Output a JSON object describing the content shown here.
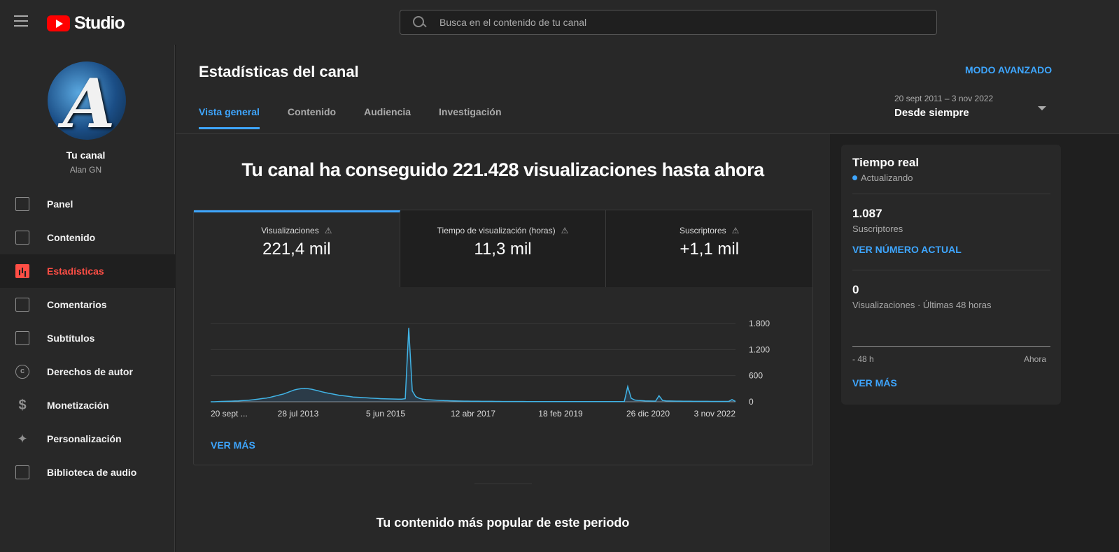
{
  "search": {
    "placeholder": "Busca en el contenido de tu canal"
  },
  "brand": {
    "studio_label": "Studio"
  },
  "channel": {
    "name": "Tu canal",
    "user": "Alan GN"
  },
  "sidebar": {
    "items": [
      {
        "label": "Panel",
        "icon": "dashboard-icon"
      },
      {
        "label": "Contenido",
        "icon": "content-icon"
      },
      {
        "label": "Estadísticas",
        "icon": "analytics-icon"
      },
      {
        "label": "Comentarios",
        "icon": "comments-icon"
      },
      {
        "label": "Subtítulos",
        "icon": "subtitles-icon"
      },
      {
        "label": "Derechos de autor",
        "icon": "copyright-icon"
      },
      {
        "label": "Monetización",
        "icon": "dollar-icon"
      },
      {
        "label": "Personalización",
        "icon": "magic-wand-icon"
      },
      {
        "label": "Biblioteca de audio",
        "icon": "audio-library-icon"
      }
    ]
  },
  "header": {
    "title": "Estadísticas del canal",
    "advanced_mode": "MODO AVANZADO",
    "date_range": "20 sept 2011 – 3 nov 2022",
    "date_preset": "Desde siempre",
    "tabs": [
      "Vista general",
      "Contenido",
      "Audiencia",
      "Investigación"
    ]
  },
  "overview": {
    "headline": "Tu canal ha conseguido 221.428 visualizaciones hasta ahora",
    "metrics": [
      {
        "label": "Visualizaciones",
        "value": "221,4 mil"
      },
      {
        "label": "Tiempo de visualización (horas)",
        "value": "11,3 mil"
      },
      {
        "label": "Suscriptores",
        "value": "+1,1 mil"
      }
    ],
    "see_more": "VER MÁS",
    "popular_title": "Tu contenido más popular de este periodo"
  },
  "realtime": {
    "title": "Tiempo real",
    "status": "Actualizando",
    "subscribers_value": "1.087",
    "subscribers_label": "Suscriptores",
    "see_current": "VER NÚMERO ACTUAL",
    "views_value": "0",
    "views_label": "Visualizaciones · Últimas 48 horas",
    "axis_start": "- 48 h",
    "axis_end": "Ahora",
    "see_more": "VER MÁS"
  },
  "colors": {
    "accent": "#3ea6ff",
    "active_nav": "#ff4e45",
    "brand_red": "#ff0000"
  },
  "chart_data": {
    "type": "line",
    "x_tick_labels": [
      "20 sept ...",
      "28 jul 2013",
      "5 jun 2015",
      "12 abr 2017",
      "18 feb 2019",
      "26 dic 2020",
      "3 nov 2022"
    ],
    "y_tick_labels": [
      "0",
      "600",
      "1.200",
      "1.800"
    ],
    "ylim": [
      0,
      1800
    ],
    "grid": true,
    "series": [
      {
        "values": [
          0,
          0,
          5,
          8,
          10,
          12,
          15,
          18,
          20,
          25,
          30,
          35,
          45,
          55,
          65,
          75,
          85,
          100,
          120,
          140,
          160,
          180,
          210,
          240,
          270,
          290,
          300,
          310,
          300,
          290,
          270,
          250,
          230,
          210,
          195,
          180,
          165,
          150,
          140,
          130,
          120,
          110,
          105,
          100,
          95,
          90,
          85,
          80,
          75,
          70,
          68,
          66,
          64,
          62,
          60,
          60,
          70,
          1700,
          250,
          120,
          80,
          60,
          50,
          45,
          40,
          35,
          30,
          28,
          25,
          22,
          20,
          18,
          16,
          15,
          14,
          13,
          12,
          11,
          10,
          10,
          9,
          9,
          8,
          8,
          7,
          7,
          7,
          6,
          6,
          6,
          6,
          5,
          5,
          5,
          5,
          5,
          5,
          5,
          5,
          5,
          5,
          5,
          5,
          5,
          5,
          5,
          5,
          5,
          5,
          5,
          5,
          5,
          5,
          5,
          5,
          5,
          5,
          5,
          5,
          5,
          350,
          80,
          40,
          30,
          25,
          20,
          18,
          16,
          15,
          140,
          30,
          20,
          18,
          16,
          15,
          14,
          13,
          12,
          11,
          10,
          10,
          10,
          9,
          9,
          8,
          8,
          8,
          8,
          8,
          8,
          50,
          8
        ]
      }
    ]
  }
}
